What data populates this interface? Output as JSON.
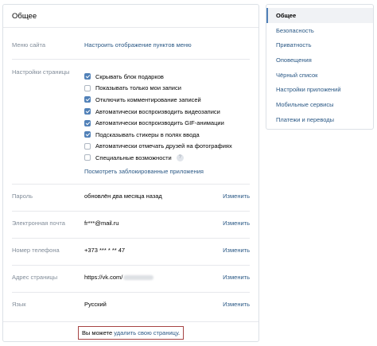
{
  "panel": {
    "title": "Общее",
    "menu_row": {
      "label": "Меню сайта",
      "link": "Настроить отображение пунктов меню"
    },
    "page_settings": {
      "label": "Настройки страницы",
      "options": [
        {
          "label": "Скрывать блок подарков",
          "checked": true
        },
        {
          "label": "Показывать только мои записи",
          "checked": false
        },
        {
          "label": "Отключить комментирование записей",
          "checked": true
        },
        {
          "label": "Автоматически воспроизводить видеозаписи",
          "checked": true
        },
        {
          "label": "Автоматически воспроизводить GIF-анимации",
          "checked": true
        },
        {
          "label": "Подсказывать стикеры в полях ввода",
          "checked": true
        },
        {
          "label": "Автоматически отмечать друзей на фотографиях",
          "checked": false
        },
        {
          "label": "Специальные возможности",
          "checked": false,
          "help": "?"
        }
      ],
      "blocked_apps_link": "Посмотреть заблокированные приложения"
    },
    "password": {
      "label": "Пароль",
      "value": "обновлён два месяца назад",
      "action": "Изменить"
    },
    "email": {
      "label": "Электронная почта",
      "value": "fr***@mail.ru",
      "action": "Изменить"
    },
    "phone": {
      "label": "Номер телефона",
      "value": "+373 *** * ** 47",
      "action": "Изменить"
    },
    "address": {
      "label": "Адрес страницы",
      "value": "https://vk.com/",
      "action": "Изменить"
    },
    "language": {
      "label": "Язык",
      "value": "Русский",
      "action": "Изменить"
    },
    "footer": {
      "text": "Вы можете ",
      "link": "удалить свою страницу",
      "suffix": "."
    }
  },
  "menu": {
    "items": [
      {
        "label": "Общее",
        "active": true
      },
      {
        "label": "Безопасность"
      },
      {
        "label": "Приватность"
      },
      {
        "label": "Оповещения"
      },
      {
        "label": "Чёрный список"
      },
      {
        "label": "Настройки приложений"
      },
      {
        "label": "Мобильные сервисы"
      },
      {
        "label": "Платежи и переводы"
      }
    ]
  },
  "colors": {
    "accent": "#5181b8",
    "link": "#2a5885",
    "highlight_border": "#a64444"
  }
}
